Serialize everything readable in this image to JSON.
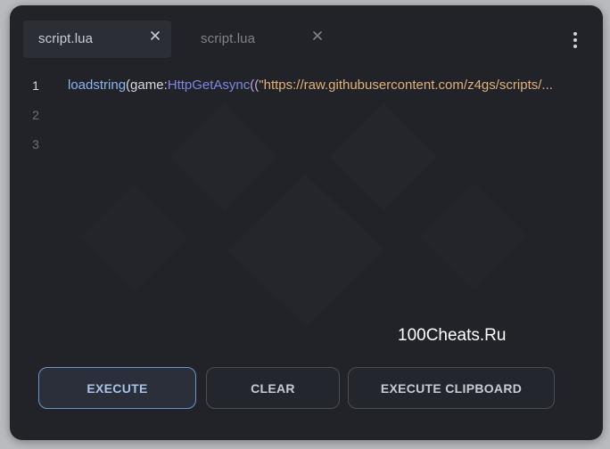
{
  "tabs": [
    {
      "label": "script.lua",
      "active": true
    },
    {
      "label": "script.lua",
      "active": false
    }
  ],
  "editor": {
    "lines": [
      {
        "number": "1",
        "tokens": [
          {
            "cls": "tok-fn",
            "text": "loadstring"
          },
          {
            "cls": "tok-plain",
            "text": "(game:"
          },
          {
            "cls": "tok-method",
            "text": "HttpGetAsync"
          },
          {
            "cls": "tok-paren",
            "text": "(("
          },
          {
            "cls": "tok-str",
            "text": "\"https://raw.githubusercontent.com/z4gs/scripts/..."
          }
        ]
      },
      {
        "number": "2",
        "tokens": []
      },
      {
        "number": "3",
        "tokens": []
      }
    ]
  },
  "watermark": "100Cheats.Ru",
  "buttons": {
    "execute": "EXECUTE",
    "clear": "CLEAR",
    "execute_clipboard": "EXECUTE CLIPBOARD"
  },
  "colors": {
    "window_bg": "#222328",
    "accent_blue": "#6e95c9",
    "string_orange": "#e1b07a"
  },
  "icons": {
    "tab_close": "close-icon",
    "menu": "kebab-menu-icon",
    "background": "diamond-logo-icon"
  }
}
